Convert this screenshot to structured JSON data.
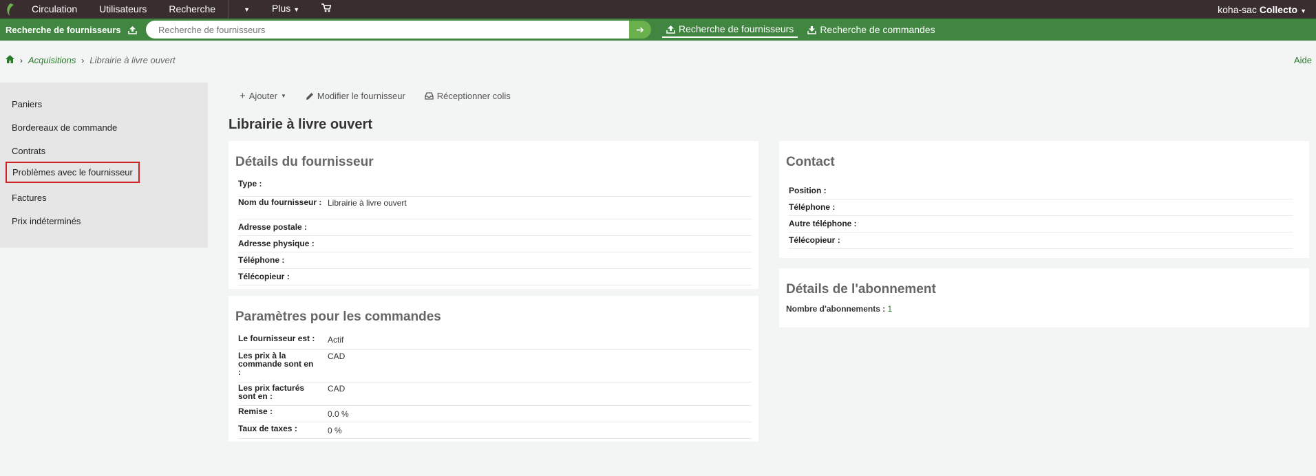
{
  "topbar": {
    "items": [
      "Circulation",
      "Utilisateurs",
      "Recherche"
    ],
    "plus": "Plus",
    "user": "koha-sac",
    "library": "Collecto"
  },
  "searchbar": {
    "label": "Recherche de fournisseurs",
    "placeholder": "Recherche de fournisseurs",
    "tab_vendors": "Recherche de fournisseurs",
    "tab_orders": "Recherche de commandes"
  },
  "breadcrumb": {
    "acquisitions": "Acquisitions",
    "current": "Librairie à livre ouvert"
  },
  "help": "Aide",
  "sidebar": {
    "items": [
      "Paniers",
      "Bordereaux de commande",
      "Contrats",
      "Problèmes avec le fournisseur",
      "Factures",
      "Prix indéterminés"
    ]
  },
  "toolbar": {
    "add": "Ajouter",
    "edit": "Modifier le fournisseur",
    "receive": "Réceptionner colis"
  },
  "page_title": "Librairie à livre ouvert",
  "vendor_details": {
    "title": "Détails du fournisseur",
    "type_label": "Type :",
    "name_label": "Nom du fournisseur :",
    "name_value": "Librairie à livre ouvert",
    "postal_label": "Adresse postale :",
    "physical_label": "Adresse physique :",
    "phone_label": "Téléphone :",
    "fax_label": "Télécopieur :"
  },
  "order_params": {
    "title": "Paramètres pour les commandes",
    "status_label": "Le fournisseur est :",
    "status_value": "Actif",
    "list_prices_label": "Les prix à la commande sont en :",
    "list_prices_value": "CAD",
    "invoice_prices_label": "Les prix facturés sont en :",
    "invoice_prices_value": "CAD",
    "discount_label": "Remise :",
    "discount_value": "0.0 %",
    "tax_label": "Taux de taxes :",
    "tax_value": "0 %"
  },
  "contact": {
    "title": "Contact",
    "position_label": "Position :",
    "phone_label": "Téléphone :",
    "alt_phone_label": "Autre téléphone :",
    "fax_label": "Télécopieur :"
  },
  "subscription": {
    "title": "Détails de l'abonnement",
    "count_label": "Nombre d'abonnements :",
    "count_value": "1"
  }
}
